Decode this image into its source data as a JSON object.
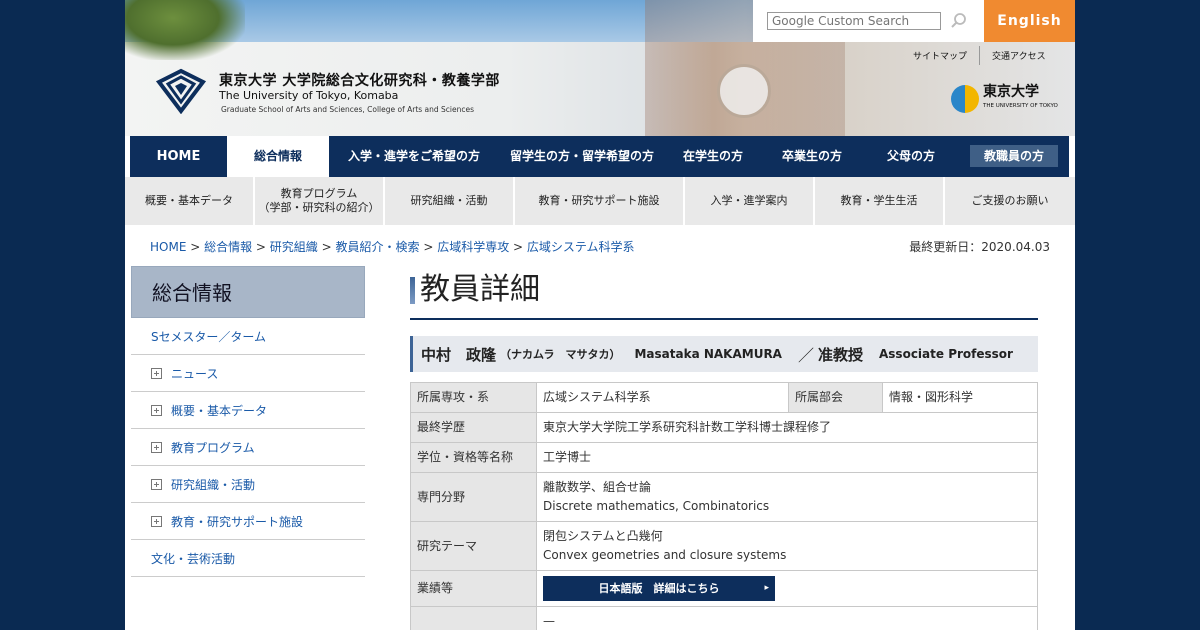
{
  "header": {
    "univ_jp": "東京大学 大学院総合文化研究科・教養学部",
    "univ_en": "The University of Tokyo, Komaba",
    "univ_sub": "Graduate School of Arts and Sciences, College of Arts and Sciences",
    "search_placeholder": "Google Custom Search",
    "english_label": "English",
    "util_links": [
      "サイトマップ",
      "交通アクセス"
    ],
    "ut_logo_jp": "東京大学",
    "ut_logo_en": "THE UNIVERSITY OF TOKYO"
  },
  "gnav": {
    "items": [
      "HOME",
      "総合情報",
      "入学・進学をご希望の方",
      "留学生の方・留学希望の方",
      "在学生の方",
      "卒業生の方",
      "父母の方",
      "教職員の方"
    ]
  },
  "snav": {
    "items": [
      "概要・基本データ",
      "教育プログラム\n（学部・研究科の紹介）",
      "研究組織・活動",
      "教育・研究サポート施設",
      "入学・進学案内",
      "教育・学生生活",
      "ご支援のお願い"
    ]
  },
  "breadcrumb": {
    "items": [
      "HOME",
      "総合情報",
      "研究組織",
      "教員紹介・検索",
      "広域科学専攻",
      "広域システム科学系"
    ],
    "separator": " > "
  },
  "updated": "最終更新日：2020.04.03",
  "sidebar": {
    "heading": "総合情報",
    "items": [
      {
        "label": "Sセメスター／ターム",
        "expandable": false
      },
      {
        "label": "ニュース",
        "expandable": true
      },
      {
        "label": "概要・基本データ",
        "expandable": true
      },
      {
        "label": "教育プログラム",
        "expandable": true
      },
      {
        "label": "研究組織・活動",
        "expandable": true
      },
      {
        "label": "教育・研究サポート施設",
        "expandable": true
      },
      {
        "label": "文化・芸術活動",
        "expandable": false
      }
    ]
  },
  "main": {
    "title": "教員詳細",
    "person": {
      "name": "中村　政隆",
      "kana": "（ナカムラ　マサタカ）",
      "name_en": "Masataka NAKAMURA",
      "sep": "／",
      "title": "准教授",
      "title_en": "Associate Professor"
    },
    "table": {
      "dept_label": "所属専攻・系",
      "dept_value": "広域システム科学系",
      "section_label": "所属部会",
      "section_value": "情報・図形科学",
      "edu_label": "最終学歴",
      "edu_value": "東京大学大学院工学系研究科計数工学科博士課程修了",
      "degree_label": "学位・資格等名称",
      "degree_value": "工学博士",
      "field_label": "専門分野",
      "field_value_jp": "離散数学、組合せ論",
      "field_value_en": "Discrete mathematics, Combinatorics",
      "theme_label": "研究テーマ",
      "theme_value_jp": "閉包システムと凸幾何",
      "theme_value_en": "Convex geometries and closure systems",
      "works_label": "業績等",
      "works_button": "日本語版　詳細はこちら",
      "last_value": "—"
    }
  }
}
